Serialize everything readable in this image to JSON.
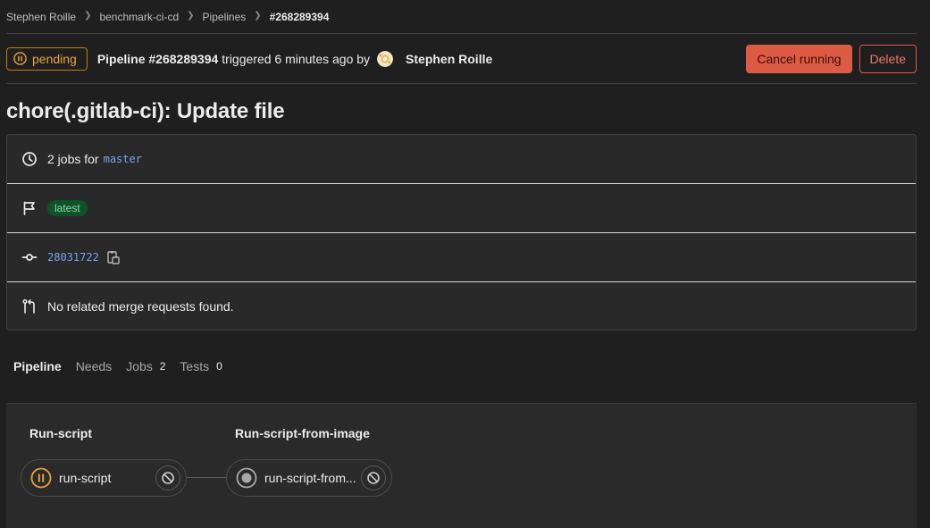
{
  "breadcrumb": [
    "Stephen Roille",
    "benchmark-ci-cd",
    "Pipelines",
    "#268289394"
  ],
  "header": {
    "status": "pending",
    "pipeline_label": "Pipeline #268289394",
    "triggered_text": "triggered 6 minutes ago by",
    "user": "Stephen Roille",
    "cancel_label": "Cancel running",
    "delete_label": "Delete"
  },
  "title": "chore(.gitlab-ci): Update file",
  "info": {
    "jobs_text": "2 jobs for",
    "branch": "master",
    "latest_badge": "latest",
    "commit_sha": "28031722",
    "merge_requests": "No related merge requests found."
  },
  "tabs": [
    {
      "label": "Pipeline",
      "count": ""
    },
    {
      "label": "Needs",
      "count": ""
    },
    {
      "label": "Jobs",
      "count": "2"
    },
    {
      "label": "Tests",
      "count": "0"
    }
  ],
  "graph": {
    "stages": [
      {
        "title": "Run-script",
        "job": "run-script",
        "job_status": "pending"
      },
      {
        "title": "Run-script-from-image",
        "job": "run-script-from...",
        "job_status": "created"
      }
    ]
  },
  "colors": {
    "pending": "#e9a23b",
    "danger": "#dd5b45",
    "link": "#74a3f0",
    "latest_bg": "#0d532a"
  },
  "icons": [
    "pause-icon",
    "clock-icon",
    "flag-icon",
    "commit-icon",
    "copy-icon",
    "merge-request-icon",
    "cancel-icon",
    "created-status-icon"
  ]
}
